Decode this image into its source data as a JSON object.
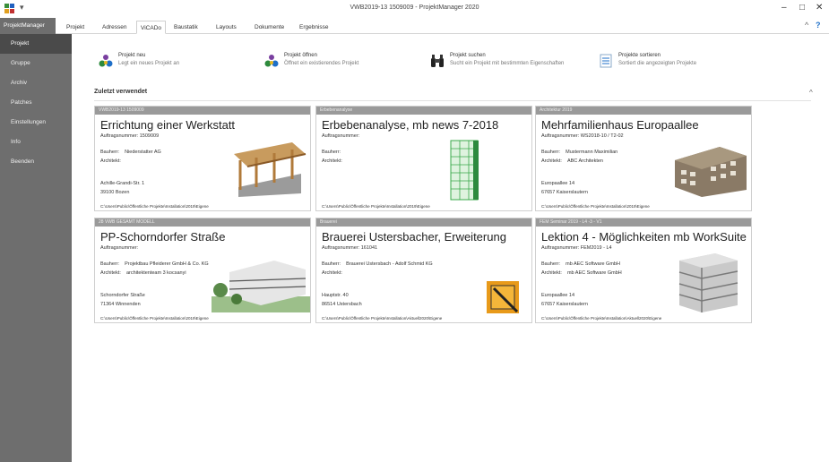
{
  "window": {
    "title": "VWB2019-13 1509009 - ProjektManager 2020",
    "controls": {
      "minimize": "–",
      "maximize": "□",
      "close": "✕"
    }
  },
  "ribbon": {
    "app_tab": "ProjektManager",
    "tabs": [
      "Projekt",
      "Adressen",
      "ViCADo",
      "Baustatik",
      "Layouts",
      "Dokumente",
      "Ergebnisse"
    ],
    "collapse": "^",
    "help": "?"
  },
  "sidebar": {
    "items": [
      "Projekt",
      "Gruppe",
      "Archiv",
      "Patches",
      "Einstellungen",
      "Info",
      "Beenden"
    ]
  },
  "actions": [
    {
      "title": "Projekt neu",
      "desc": "Legt ein neues Projekt an",
      "icon": "new-project-icon"
    },
    {
      "title": "Projekt öffnen",
      "desc": "Öffnet ein existierendes Projekt",
      "icon": "open-project-icon"
    },
    {
      "title": "Projekt suchen",
      "desc": "Sucht ein Projekt mit bestimmten Eigenschaften",
      "icon": "binoculars-icon"
    },
    {
      "title": "Projekte sortieren",
      "desc": "Sortiert die angezeigten Projekte",
      "icon": "sort-projects-icon"
    }
  ],
  "recent": {
    "heading": "Zuletzt verwendet",
    "collapse": "^",
    "labels": {
      "order": "Auftragsnummer:",
      "client": "Bauherr:",
      "architect": "Architekt:"
    },
    "cards": [
      {
        "header": "VWB2019-13 1509009",
        "title": "Errichtung einer Werkstatt",
        "order": "1509009",
        "client": "Niederstatter AG",
        "architect": "",
        "street": "Achille-Grandi-Str. 1",
        "city": "39100 Bozen",
        "path": "C:\\Users\\Public\\Öffentliche Projekte\\Installation\\2019\\Eigene",
        "image": "timber-frame-workshop"
      },
      {
        "header": "Erbebenanalyse",
        "title": "Erbebenanalyse, mb news 7-2018",
        "order": "",
        "client": "",
        "architect": "",
        "street": "",
        "city": "",
        "path": "C:\\Users\\Public\\Öffentliche Projekte\\Installation\\2019\\Eigene",
        "image": "green-structural-model"
      },
      {
        "header": "Architektur 2019",
        "title": "Mehrfamilienhaus Europaallee",
        "order": "WS2018-10 / T2-02",
        "client": "Mustermann Maximilian",
        "architect": "ABC Architekten",
        "street": "Europaallee 14",
        "city": "67657 Kaiserslautern",
        "path": "C:\\Users\\Public\\Öffentliche Projekte\\Installation\\2019\\Eigene",
        "image": "apartment-building-render"
      },
      {
        "header": "28 VWB GESAMT MODELL",
        "title": "PP-Schorndorfer Straße",
        "order": "",
        "client": "Projektbau Pfleiderer GmbH & Co. KG",
        "architect": "architektenteam 3 kocsanyi",
        "street": "Schorndorfer Straße",
        "city": "71364 Winnenden",
        "path": "C:\\Users\\Public\\Öffentliche Projekte\\Installation\\2019\\Eigene",
        "image": "residential-complex-render"
      },
      {
        "header": "Brauerei",
        "title": "Brauerei Ustersbacher, Erweiterung",
        "order": "161041",
        "client": "Brauerei Ustersbach - Adolf Schmid KG",
        "architect": "",
        "street": "Hauptstr. 40",
        "city": "86514 Ustersbach",
        "path": "C:\\Users\\Public\\Öffentliche Projekte\\Installation\\Aktuell2020\\Eigene",
        "image": "brewery-logo"
      },
      {
        "header": "FEM Seminar 2019 - L4 -3 - V1",
        "title": "Lektion 4 - Möglichkeiten mb WorkSuite",
        "order": "FEM2019 - L4",
        "client": "mb AEC Software GmbH",
        "architect": "mb AEC Software GmbH",
        "street": "Europaallee 14",
        "city": "67657 Kaiserslautern",
        "path": "C:\\Users\\Public\\Öffentliche Projekte\\Installation\\Aktuell2020\\Eigene",
        "image": "concrete-frame-model"
      }
    ]
  },
  "colors": {
    "sidebar": "#6e6e6e",
    "sidebar_active": "#4a4a4a",
    "card_header": "#9a9a9a",
    "accent_blue": "#1e6fc8"
  }
}
